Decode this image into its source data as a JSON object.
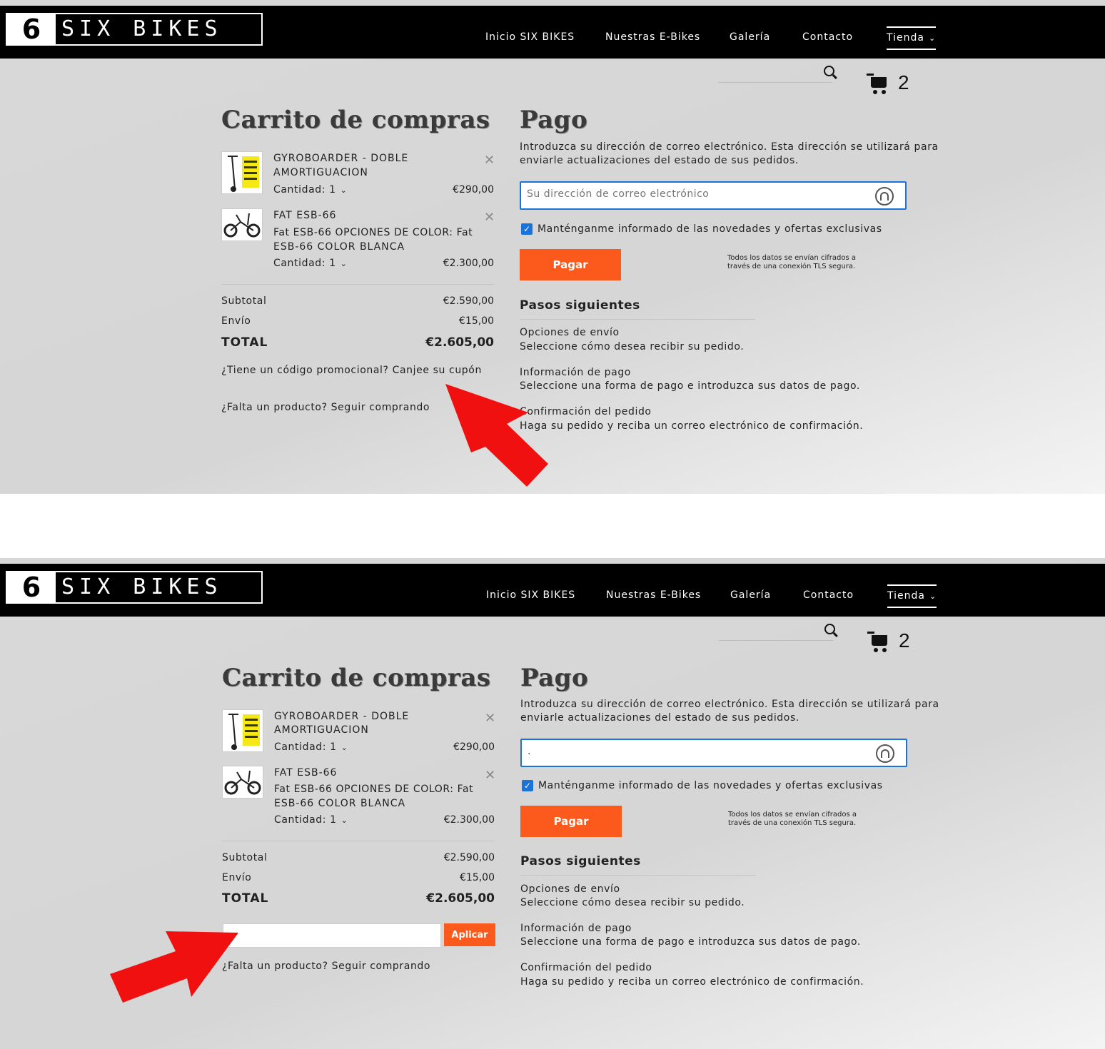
{
  "header": {
    "logo_number": "6",
    "logo_text": "SIX BIKES",
    "nav": [
      "Inicio SIX BIKES",
      "Nuestras E-Bikes",
      "Galería",
      "Contacto",
      "Tienda"
    ],
    "cart_count": "2"
  },
  "cart": {
    "title": "Carrito de compras",
    "items": [
      {
        "name_line1": "GYROBOARDER - DOBLE",
        "name_line2": "AMORTIGUACION",
        "quantity_label": "Cantidad: 1",
        "price": "€290,00"
      },
      {
        "name_line1": "FAT ESB-66",
        "option_line1": "Fat ESB-66 OPCIONES DE COLOR: Fat",
        "option_line2": "ESB-66 COLOR BLANCA",
        "quantity_label": "Cantidad: 1",
        "price": "€2.300,00"
      }
    ],
    "subtotal_label": "Subtotal",
    "subtotal_value": "€2.590,00",
    "shipping_label": "Envío",
    "shipping_value": "€15,00",
    "total_label": "TOTAL",
    "total_value": "€2.605,00",
    "promo_text": "¿Tiene un código promocional? Canjee su cupón",
    "apply_label": "Aplicar",
    "continue_text": "¿Falta un producto? Seguir comprando"
  },
  "checkout": {
    "title": "Pago",
    "intro_line1": "Introduzca su dirección de correo electrónico. Esta dirección se utilizará para",
    "intro_line2": "enviarle actualizaciones del estado de sus pedidos.",
    "email_placeholder": "Su dirección de correo electrónico",
    "email_value_second": ".",
    "newsletter_label": "Manténganme informado de las novedades y ofertas exclusivas",
    "pay_label": "Pagar",
    "secure_line1": "Todos los datos se envían cifrados a",
    "secure_line2": "través de una conexión TLS segura.",
    "next_steps_title": "Pasos siguientes",
    "steps": [
      {
        "title": "Opciones de envío",
        "desc": "Seleccione cómo desea recibir su pedido."
      },
      {
        "title": "Información de pago",
        "desc": "Seleccione una forma de pago e introduzca sus datos de pago."
      },
      {
        "title": "Confirmación del pedido",
        "desc": "Haga su pedido y reciba un correo electrónico de confirmación."
      }
    ]
  },
  "colors": {
    "accent": "#fb5a1c",
    "annotation_arrow": "#f01010",
    "focus_border": "#1a73d9"
  }
}
